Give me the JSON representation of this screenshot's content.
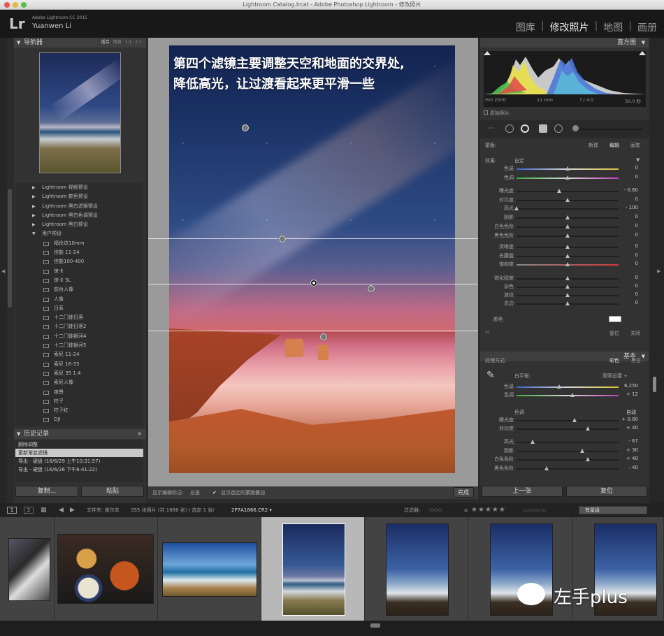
{
  "window": {
    "title": "Lightroom Catalog.lrcat - Adobe Photoshop Lightroom - 修改照片"
  },
  "app": {
    "logo": "Lr",
    "product": "Adobe Lightroom CC 2015",
    "user": "Yuanwen Li"
  },
  "modules": [
    {
      "label": "图库"
    },
    {
      "label": "修改照片",
      "active": true
    },
    {
      "label": "地图"
    },
    {
      "label": "画册"
    }
  ],
  "navigator": {
    "title": "导航器",
    "options": [
      "适合",
      "填满",
      "1:1",
      "2:1"
    ]
  },
  "presets": [
    {
      "label": "Lightroom 视频预设",
      "type": "folder"
    },
    {
      "label": "Lightroom 颜色预设",
      "type": "folder"
    },
    {
      "label": "Lightroom 黑白滤镜预设",
      "type": "folder"
    },
    {
      "label": "Lightroom 黑白色调预设",
      "type": "folder"
    },
    {
      "label": "Lightroom 黑白预设",
      "type": "folder"
    },
    {
      "label": "用户预设",
      "type": "open"
    },
    {
      "label": "福伦达10mm",
      "type": "item"
    },
    {
      "label": "佳能 11-24",
      "type": "item"
    },
    {
      "label": "佳能100-400",
      "type": "item"
    },
    {
      "label": "徕卡",
      "type": "item"
    },
    {
      "label": "徕卡 SL",
      "type": "item"
    },
    {
      "label": "前台人像",
      "type": "item"
    },
    {
      "label": "人像",
      "type": "item"
    },
    {
      "label": "日系",
      "type": "item"
    },
    {
      "label": "十二门徒日落",
      "type": "item"
    },
    {
      "label": "十二门徒日落2",
      "type": "item"
    },
    {
      "label": "十二门徒银河4",
      "type": "item"
    },
    {
      "label": "十二门徒银河5",
      "type": "item"
    },
    {
      "label": "索尼 11-24",
      "type": "item"
    },
    {
      "label": "索尼 16-35",
      "type": "item"
    },
    {
      "label": "索尼 35 1.4",
      "type": "item"
    },
    {
      "label": "索尼人像",
      "type": "item"
    },
    {
      "label": "夜景",
      "type": "item"
    },
    {
      "label": "柱子",
      "type": "item"
    },
    {
      "label": "柱子红",
      "type": "item"
    },
    {
      "label": "DJI",
      "type": "item"
    }
  ],
  "history": {
    "title": "历史记录",
    "items": [
      {
        "label": "删除调整"
      },
      {
        "label": "更新渐变滤镜",
        "selected": true
      },
      {
        "label": "导出 - 硬盘 (16/6/29 上午10:31:57)"
      },
      {
        "label": "导出 - 硬盘 (16/6/26 下午6:41:22)"
      }
    ]
  },
  "left_buttons": {
    "copy": "复制...",
    "paste": "粘贴"
  },
  "photo_caption": {
    "line1": "第四个滤镜主要调整天空和地面的交界处,",
    "line2": "降低高光，让过渡看起来更平滑一些"
  },
  "center_toolbar": {
    "show_pins_label": "显示编辑标记:",
    "show_pins_value": "总是",
    "overlay_label": "显示选定的蒙版叠加",
    "done": "完成"
  },
  "histogram": {
    "title": "直方图",
    "iso": "ISO 2500",
    "focal": "11 mm",
    "aperture": "f / 4.0",
    "shutter": "30.0 秒",
    "original": "原始照片"
  },
  "mask": {
    "label": "蒙版:",
    "new": "新建",
    "edit": "编辑",
    "brush": "画笔"
  },
  "effect": {
    "label": "效果:",
    "value": "自定"
  },
  "sliders_group1": [
    {
      "label": "色温",
      "pos": 0.5,
      "value": "0",
      "track": "temp"
    },
    {
      "label": "色调",
      "pos": 0.5,
      "value": "0",
      "track": "tint"
    }
  ],
  "sliders_group2": [
    {
      "label": "曝光度",
      "pos": 0.42,
      "value": "- 0.60"
    },
    {
      "label": "对比度",
      "pos": 0.5,
      "value": "0"
    },
    {
      "label": "高光",
      "pos": 0.0,
      "value": "- 100"
    },
    {
      "label": "阴影",
      "pos": 0.5,
      "value": "0"
    },
    {
      "label": "白色色阶",
      "pos": 0.5,
      "value": "0"
    },
    {
      "label": "黑色色阶",
      "pos": 0.5,
      "value": "0"
    }
  ],
  "sliders_group3": [
    {
      "label": "清晰度",
      "pos": 0.5,
      "value": "0"
    },
    {
      "label": "去朦胧",
      "pos": 0.5,
      "value": "0"
    },
    {
      "label": "饱和度",
      "pos": 0.5,
      "value": "0",
      "track": "sat"
    }
  ],
  "sliders_group4": [
    {
      "label": "锐化程度",
      "pos": 0.5,
      "value": "0"
    },
    {
      "label": "杂色",
      "pos": 0.5,
      "value": "0"
    },
    {
      "label": "波纹",
      "pos": 0.5,
      "value": "0"
    },
    {
      "label": "去边",
      "pos": 0.5,
      "value": "0"
    }
  ],
  "mask_footer": {
    "color": "颜色",
    "reset": "复位",
    "close": "关闭"
  },
  "basic": {
    "title": "基本",
    "treatment_label": "处理方式:",
    "color": "彩色",
    "bw": "黑白",
    "wb_label": "白平衡:",
    "wb_value": "原照设置 ÷",
    "wb": [
      {
        "label": "色温",
        "pos": 0.42,
        "value": "6,250",
        "track": "temp"
      },
      {
        "label": "色调",
        "pos": 0.55,
        "value": "+ 12",
        "track": "tint"
      }
    ],
    "tone_label": "色调",
    "auto": "自动",
    "tone": [
      {
        "label": "曝光度",
        "pos": 0.57,
        "value": "+ 0.80"
      },
      {
        "label": "对比度",
        "pos": 0.7,
        "value": "+ 40"
      }
    ],
    "presence": [
      {
        "label": "高光",
        "pos": 0.16,
        "value": "- 67"
      },
      {
        "label": "阴影",
        "pos": 0.65,
        "value": "+ 30"
      },
      {
        "label": "白色色阶",
        "pos": 0.7,
        "value": "+ 40"
      },
      {
        "label": "黑色色阶",
        "pos": 0.3,
        "value": "- 40"
      }
    ]
  },
  "right_buttons": {
    "prev": "上一张",
    "reset": "复位"
  },
  "filmbar": {
    "pages": [
      "1",
      "2"
    ],
    "folder": "文件夹: 墨尔本",
    "count": "355 张照片 (共 1886 张) / 选定 1 张/",
    "file": "2P7A1866.CR2 ▾",
    "filter_label": "过滤器:",
    "rating_op": "≥",
    "rating_stars": "★★★★★",
    "filter_value": "有星级"
  },
  "watermark": {
    "text": "左手plus"
  }
}
